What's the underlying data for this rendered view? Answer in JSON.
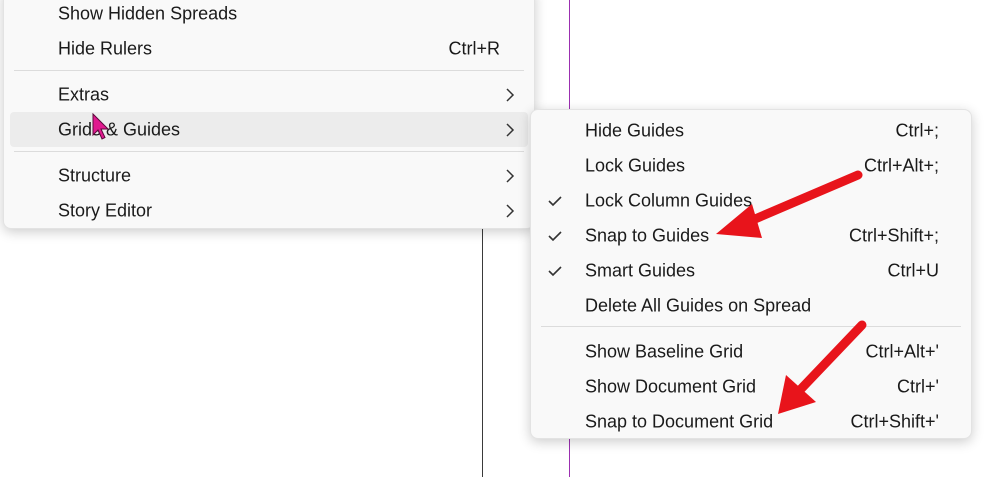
{
  "main_menu": {
    "items": [
      {
        "label": "Show Hidden Spreads",
        "shortcut": ""
      },
      {
        "label": "Hide Rulers",
        "shortcut": "Ctrl+R"
      },
      {
        "label": "Extras",
        "submenu": true
      },
      {
        "label": "Grids & Guides",
        "submenu": true,
        "highlighted": true
      },
      {
        "label": "Structure",
        "submenu": true
      },
      {
        "label": "Story Editor",
        "submenu": true
      }
    ]
  },
  "sub_menu": {
    "items": [
      {
        "label": "Hide Guides",
        "shortcut": "Ctrl+;",
        "checked": false
      },
      {
        "label": "Lock Guides",
        "shortcut": "Ctrl+Alt+;",
        "checked": false
      },
      {
        "label": "Lock Column Guides",
        "shortcut": "",
        "checked": true
      },
      {
        "label": "Snap to Guides",
        "shortcut": "Ctrl+Shift+;",
        "checked": true
      },
      {
        "label": "Smart Guides",
        "shortcut": "Ctrl+U",
        "checked": true
      },
      {
        "label": "Delete All Guides on Spread",
        "shortcut": "",
        "checked": false
      },
      {
        "label": "Show Baseline Grid",
        "shortcut": "Ctrl+Alt+'",
        "checked": false
      },
      {
        "label": "Show Document Grid",
        "shortcut": "Ctrl+'",
        "checked": false
      },
      {
        "label": "Snap to Document Grid",
        "shortcut": "Ctrl+Shift+'",
        "checked": false
      }
    ]
  },
  "colors": {
    "annotation_arrow": "#e8141b",
    "cursor": "#e0198f",
    "guide_line": "#9b2fb0",
    "menu_bg": "#f9f9f9",
    "highlight_bg": "#ececec"
  },
  "icons": {
    "submenu": "chevron-right-icon",
    "check": "check-icon",
    "cursor": "mouse-pointer-icon",
    "annotation": "red-arrow-icon"
  }
}
